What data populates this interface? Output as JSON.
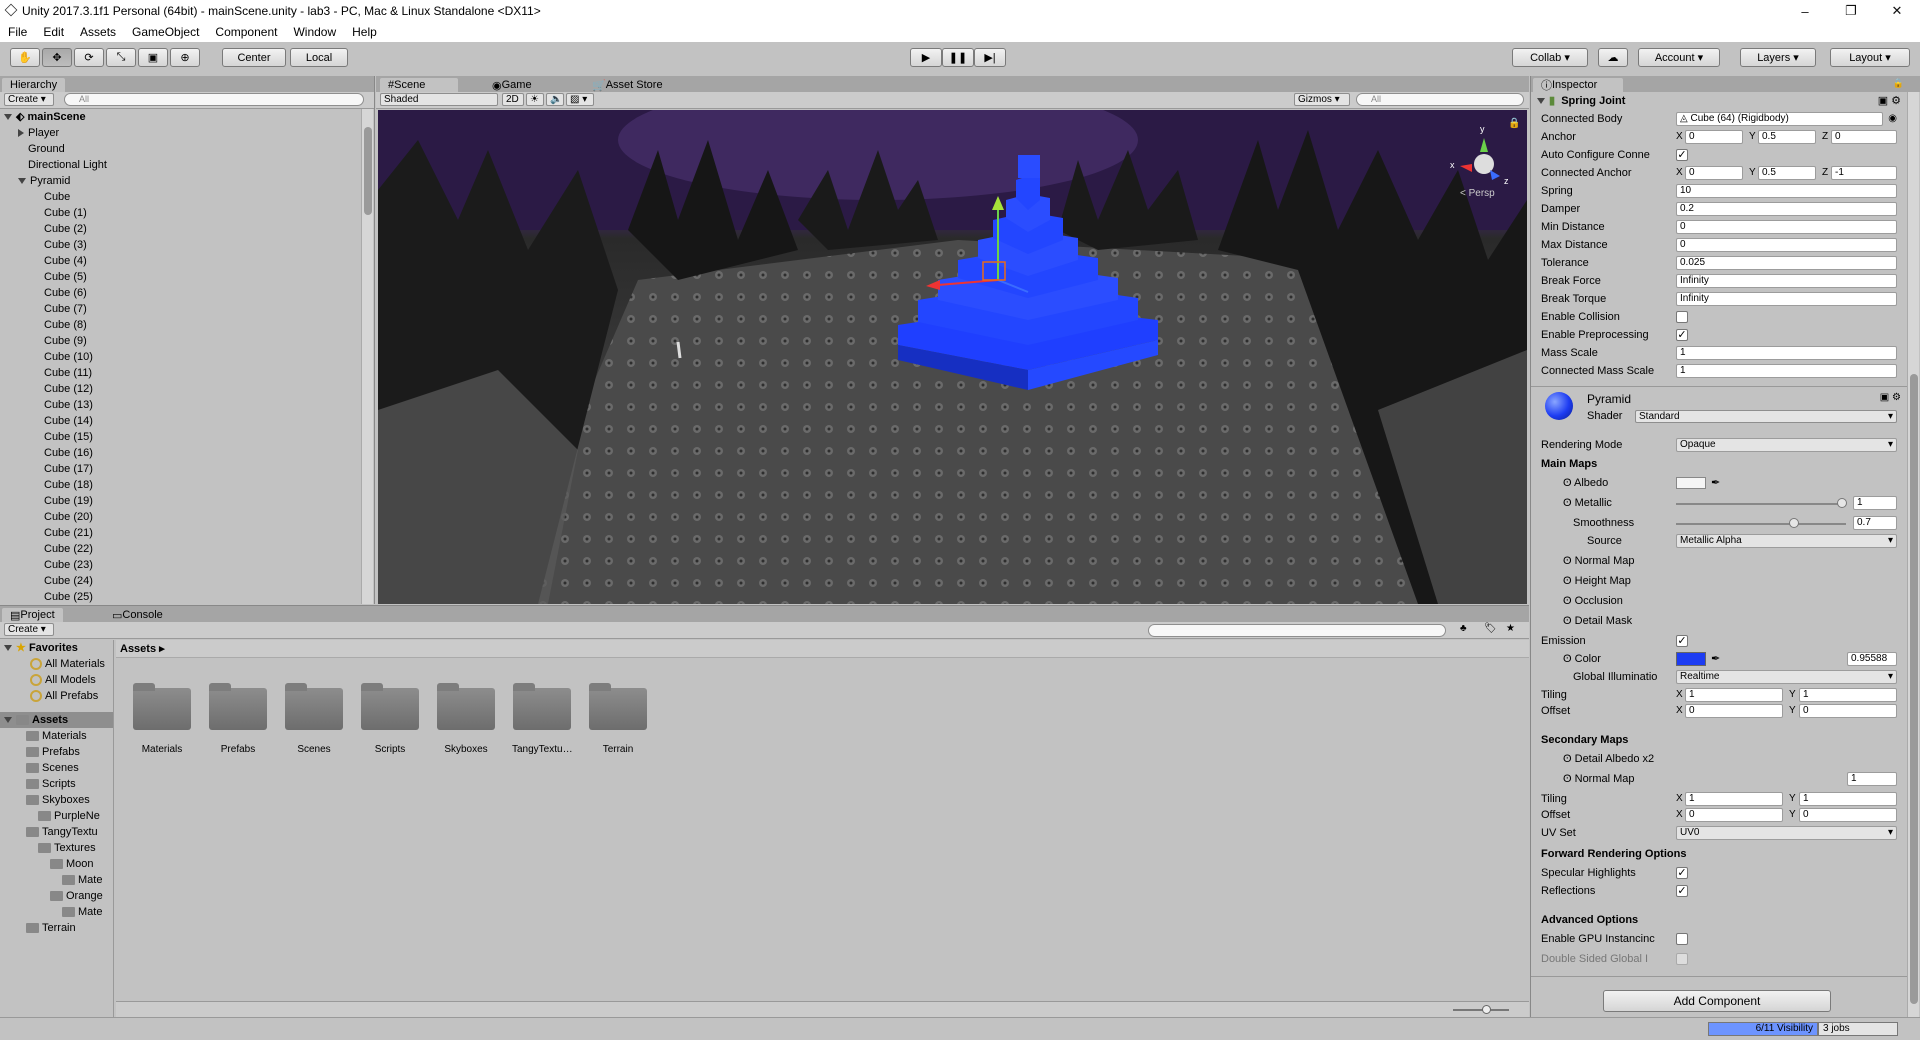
{
  "titlebar": {
    "title": "Unity 2017.3.1f1 Personal (64bit) - mainScene.unity - lab3 - PC, Mac & Linux Standalone <DX11>",
    "min": "–",
    "max": "❐",
    "close": "✕"
  },
  "menu": [
    "File",
    "Edit",
    "Assets",
    "GameObject",
    "Component",
    "Window",
    "Help"
  ],
  "toolbar": {
    "center_label": "Center",
    "local_label": "Local",
    "collab_label": "Collab ▾",
    "account_label": "Account",
    "layers_label": "Layers",
    "layout_label": "Layout"
  },
  "hierarchy": {
    "tab": "Hierarchy",
    "create": "Create",
    "search_placeholder": "All",
    "scene": "mainScene",
    "roots": [
      "Player",
      "Ground",
      "Directional Light",
      "Pyramid"
    ],
    "children": [
      "Cube",
      "Cube (1)",
      "Cube (2)",
      "Cube (3)",
      "Cube (4)",
      "Cube (5)",
      "Cube (6)",
      "Cube (7)",
      "Cube (8)",
      "Cube (9)",
      "Cube (10)",
      "Cube (11)",
      "Cube (12)",
      "Cube (13)",
      "Cube (14)",
      "Cube (15)",
      "Cube (16)",
      "Cube (17)",
      "Cube (18)",
      "Cube (19)",
      "Cube (20)",
      "Cube (21)",
      "Cube (22)",
      "Cube (23)",
      "Cube (24)",
      "Cube (25)"
    ]
  },
  "scene_view": {
    "tab_scene": "Scene",
    "tab_game": "Game",
    "tab_store": "Asset Store",
    "shading": "Shaded",
    "mode2d": "2D",
    "gizmos": "Gizmos",
    "search_placeholder": "All",
    "persp": "< Persp"
  },
  "project": {
    "tab_project": "Project",
    "tab_console": "Console",
    "create": "Create",
    "favorites_label": "Favorites",
    "favorites": [
      "All Materials",
      "All Models",
      "All Prefabs"
    ],
    "assets_label": "Assets",
    "breadcrumb": "Assets ▸",
    "tree": [
      {
        "label": "Materials",
        "indent": 1
      },
      {
        "label": "Prefabs",
        "indent": 1
      },
      {
        "label": "Scenes",
        "indent": 1
      },
      {
        "label": "Scripts",
        "indent": 1
      },
      {
        "label": "Skyboxes",
        "indent": 1
      },
      {
        "label": "PurpleNe",
        "indent": 2
      },
      {
        "label": "TangyTextu",
        "indent": 1
      },
      {
        "label": "Textures",
        "indent": 2
      },
      {
        "label": "Moon",
        "indent": 3
      },
      {
        "label": "Mate",
        "indent": 4
      },
      {
        "label": "Orange",
        "indent": 3
      },
      {
        "label": "Mate",
        "indent": 4
      },
      {
        "label": "Terrain",
        "indent": 1
      }
    ],
    "folders": [
      "Materials",
      "Prefabs",
      "Scenes",
      "Scripts",
      "Skyboxes",
      "TangyTextu…",
      "Terrain"
    ]
  },
  "inspector": {
    "tab": "Inspector",
    "spring": {
      "title": "Spring Joint",
      "connected_body_label": "Connected Body",
      "connected_body": "Cube (64) (Rigidbody)",
      "anchor_label": "Anchor",
      "anchor": {
        "x": "0",
        "y": "0.5",
        "z": "0"
      },
      "auto_label": "Auto Configure Conne",
      "conn_anchor_label": "Connected Anchor",
      "conn_anchor": {
        "x": "0",
        "y": "0.5",
        "z": "-1"
      },
      "fields": [
        {
          "k": "Spring",
          "v": "10"
        },
        {
          "k": "Damper",
          "v": "0.2"
        },
        {
          "k": "Min Distance",
          "v": "0"
        },
        {
          "k": "Max Distance",
          "v": "0"
        },
        {
          "k": "Tolerance",
          "v": "0.025"
        },
        {
          "k": "Break Force",
          "v": "Infinity"
        },
        {
          "k": "Break Torque",
          "v": "Infinity"
        }
      ],
      "enable_collision_label": "Enable Collision",
      "enable_preproc_label": "Enable Preprocessing",
      "mass_scale_label": "Mass Scale",
      "mass_scale": "1",
      "conn_mass_label": "Connected Mass Scale",
      "conn_mass": "1"
    },
    "material": {
      "name": "Pyramid",
      "shader_label": "Shader",
      "shader": "Standard",
      "rendering_mode_label": "Rendering Mode",
      "rendering_mode": "Opaque",
      "main_maps": "Main Maps",
      "albedo": "Albedo",
      "metallic": "Metallic",
      "metallic_val": "1",
      "smoothness": "Smoothness",
      "smoothness_val": "0.7",
      "source": "Source",
      "source_val": "Metallic Alpha",
      "normal_map": "Normal Map",
      "height_map": "Height Map",
      "occlusion": "Occlusion",
      "detail_mask": "Detail Mask",
      "emission": "Emission",
      "color": "Color",
      "color_val": "0.95588",
      "gi_label": "Global Illuminatio",
      "gi_val": "Realtime",
      "tiling": "Tiling",
      "offset": "Offset",
      "tiling_x": "1",
      "tiling_y": "1",
      "offset_x": "0",
      "offset_y": "0",
      "secondary_maps": "Secondary Maps",
      "detail_albedo": "Detail Albedo x2",
      "normal_map2": "Normal Map",
      "normal_map2_val": "1",
      "tiling2_x": "1",
      "tiling2_y": "1",
      "offset2_x": "0",
      "offset2_y": "0",
      "uv_set": "UV Set",
      "uv_set_val": "UV0",
      "forward": "Forward Rendering Options",
      "specular": "Specular Highlights",
      "reflections": "Reflections",
      "advanced": "Advanced Options",
      "gpu": "Enable GPU Instancinc",
      "double_sided": "Double Sided Global I"
    },
    "add_component": "Add Component"
  },
  "status": {
    "visibility": "6/11 Visibility",
    "jobs": "3 jobs"
  },
  "colors": {
    "accent_blue": "#1f3fff",
    "emission": "#1d3cf2"
  }
}
